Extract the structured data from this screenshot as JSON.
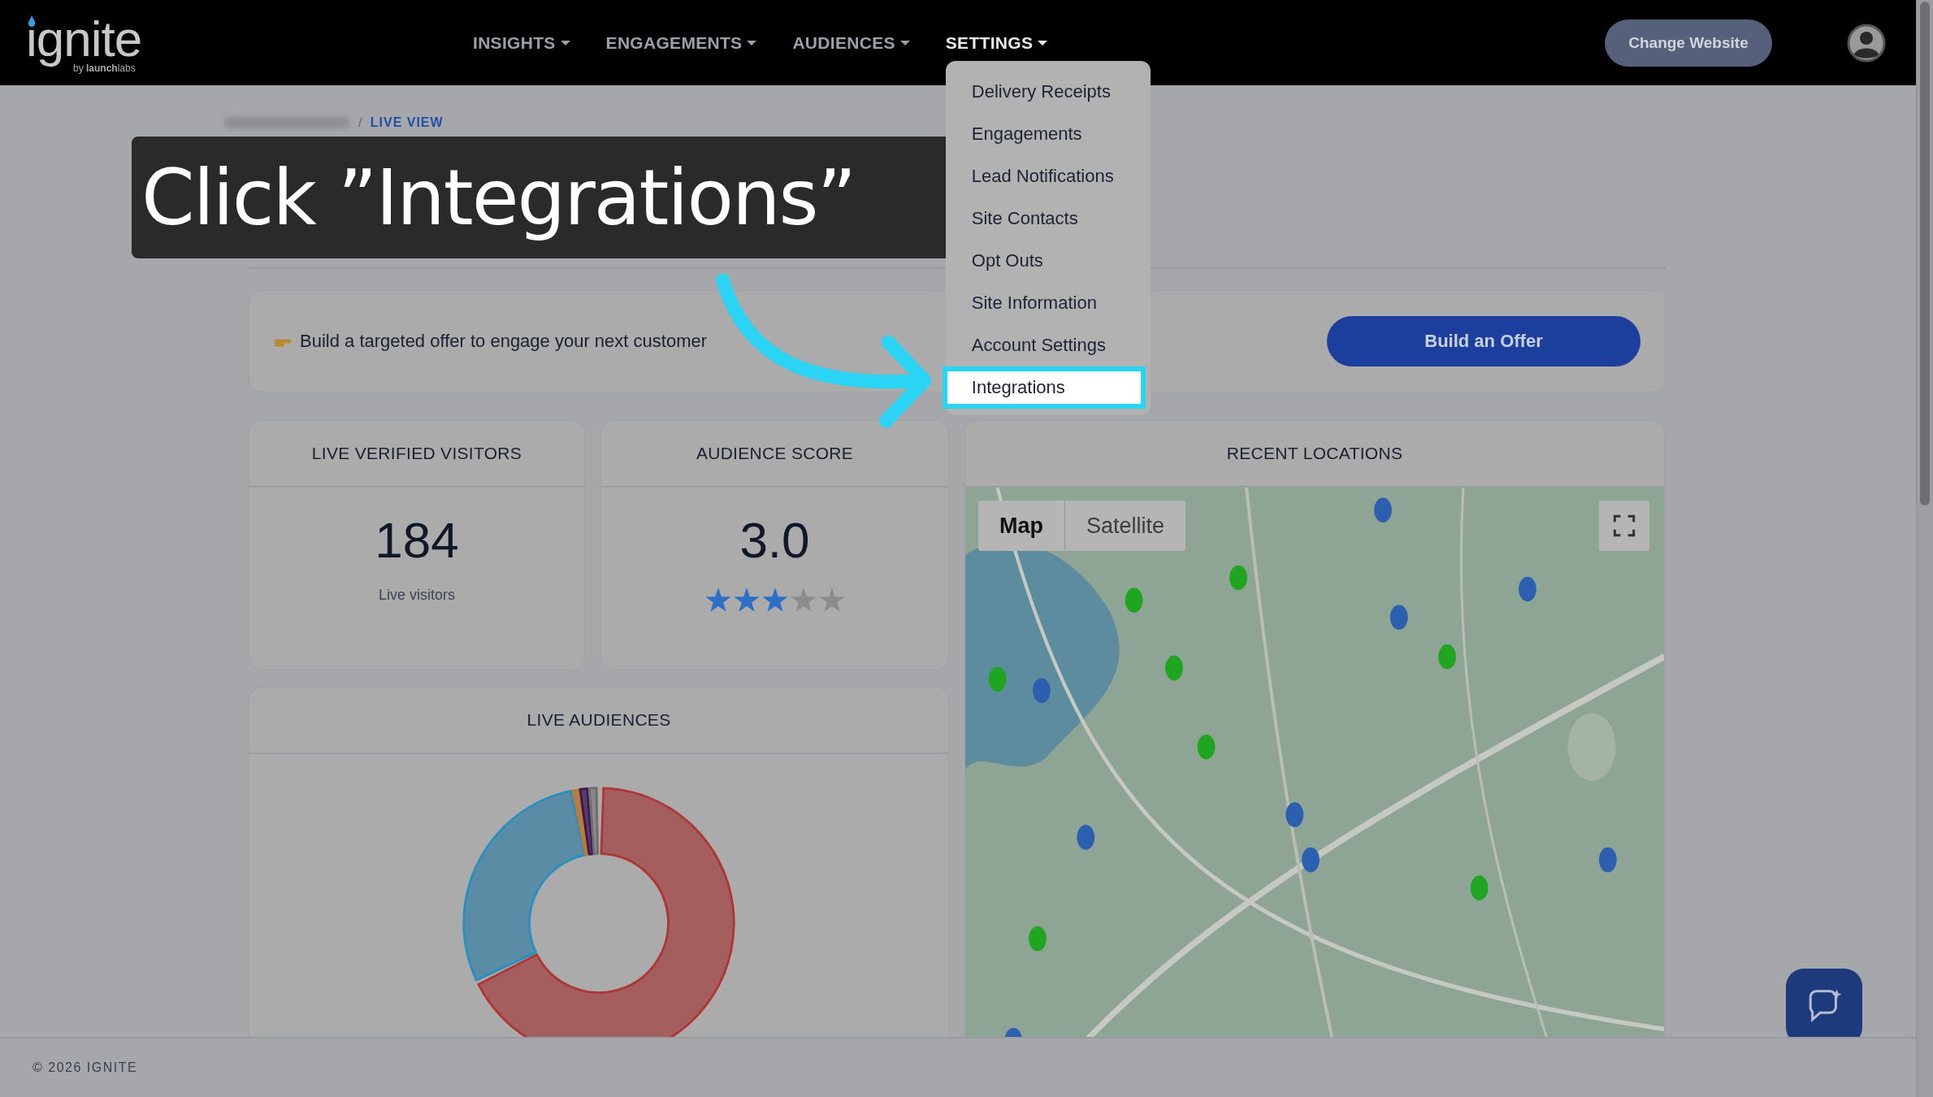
{
  "header": {
    "logo": {
      "name": "ignite",
      "tagline": "by **launch**labs"
    },
    "nav": [
      {
        "label": "INSIGHTS",
        "selected": false
      },
      {
        "label": "ENGAGEMENTS",
        "selected": false
      },
      {
        "label": "AUDIENCES",
        "selected": false
      },
      {
        "label": "SETTINGS",
        "selected": true
      }
    ],
    "settings_menu": [
      {
        "label": "Delivery Receipts",
        "selected": false
      },
      {
        "label": "Engagements",
        "selected": false
      },
      {
        "label": "Lead Notifications",
        "selected": false
      },
      {
        "label": "Site Contacts",
        "selected": false
      },
      {
        "label": "Opt Outs",
        "selected": false
      },
      {
        "label": "Site Information",
        "selected": false
      },
      {
        "label": "Account Settings",
        "selected": false
      },
      {
        "label": "Integrations",
        "selected": true
      }
    ],
    "change_website_button": "Change Website"
  },
  "breadcrumb": {
    "separator": "/",
    "current": "LIVE VIEW"
  },
  "callout": {
    "text": "Click ”Integrations”"
  },
  "offer_banner": {
    "text": "Build a targeted offer to engage your next customer",
    "button": "Build an Offer"
  },
  "stat_cards": [
    {
      "kind": "number",
      "title": "LIVE VERIFIED VISITORS",
      "value": "184",
      "caption": "Live visitors"
    },
    {
      "kind": "rating",
      "title": "AUDIENCE SCORE",
      "value": "3.0",
      "stars": 3
    }
  ],
  "map_card": {
    "title": "RECENT LOCATIONS",
    "map_type_tabs": [
      {
        "label": "Map",
        "selected": true
      },
      {
        "label": "Satellite",
        "selected": false
      }
    ]
  },
  "audiences_card": {
    "title": "LIVE AUDIENCES"
  },
  "footer": {
    "text": "© 2026 IGNITE"
  }
}
